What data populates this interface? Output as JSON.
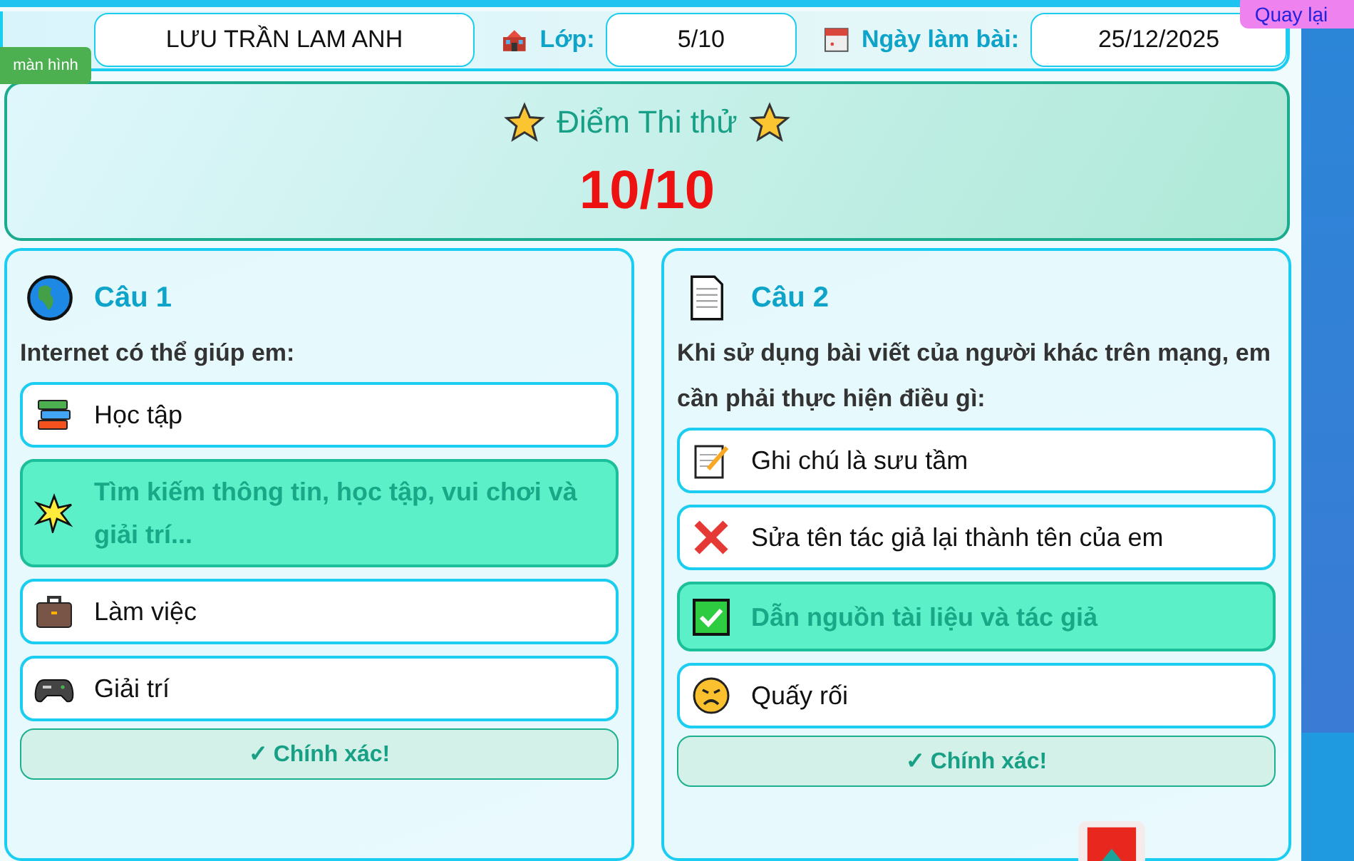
{
  "header": {
    "name_value": "LƯU TRẦN LAM ANH",
    "class_label": "Lớp:",
    "class_value": "5/10",
    "date_label": "Ngày làm bài:",
    "date_value": "25/12/2025"
  },
  "screen_button": "màn hình",
  "back_button": "Quay lại",
  "score": {
    "title": "Điểm Thi thử",
    "value": "10/10"
  },
  "questions": [
    {
      "title": "Câu 1",
      "text": "Internet có thể giúp em:",
      "options": [
        {
          "label": "Học tập",
          "selected": false
        },
        {
          "label": "Tìm kiếm thông tin, học tập, vui chơi và giải trí...",
          "selected": true
        },
        {
          "label": "Làm việc",
          "selected": false
        },
        {
          "label": "Giải trí",
          "selected": false
        }
      ],
      "feedback": "✓ Chính xác!"
    },
    {
      "title": "Câu 2",
      "text": "Khi sử dụng bài viết của người khác trên mạng, em cần phải thực hiện điều gì:",
      "options": [
        {
          "label": "Ghi chú là sưu tầm",
          "selected": false
        },
        {
          "label": "Sửa tên tác giả lại thành tên của em",
          "selected": false
        },
        {
          "label": "Dẫn nguồn tài liệu và tác giả",
          "selected": true
        },
        {
          "label": "Quấy rối",
          "selected": false
        }
      ],
      "feedback": "✓ Chính xác!"
    }
  ]
}
